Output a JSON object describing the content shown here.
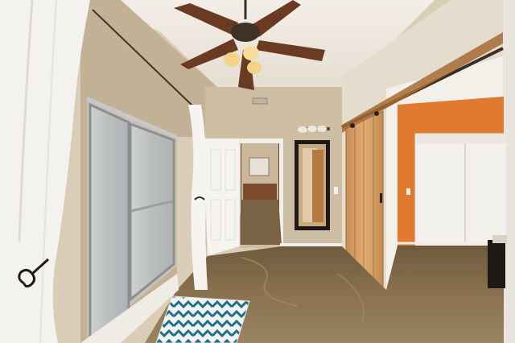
{
  "scene": {
    "description_visible_text": "",
    "palette": {
      "wall": "#cfc0a6",
      "ceiling": "#ece6dc",
      "floor": "#8a7250",
      "orange_wall": "#df7a2e",
      "barn_door": "#d9a46a",
      "fan_blade": "#6b3a22",
      "curtain": "#f4f2ee"
    },
    "icons": [
      "ceiling-fan-icon",
      "wall-sconce-icon",
      "mirror-icon",
      "barn-door-icon",
      "bath-rug-icon"
    ]
  }
}
